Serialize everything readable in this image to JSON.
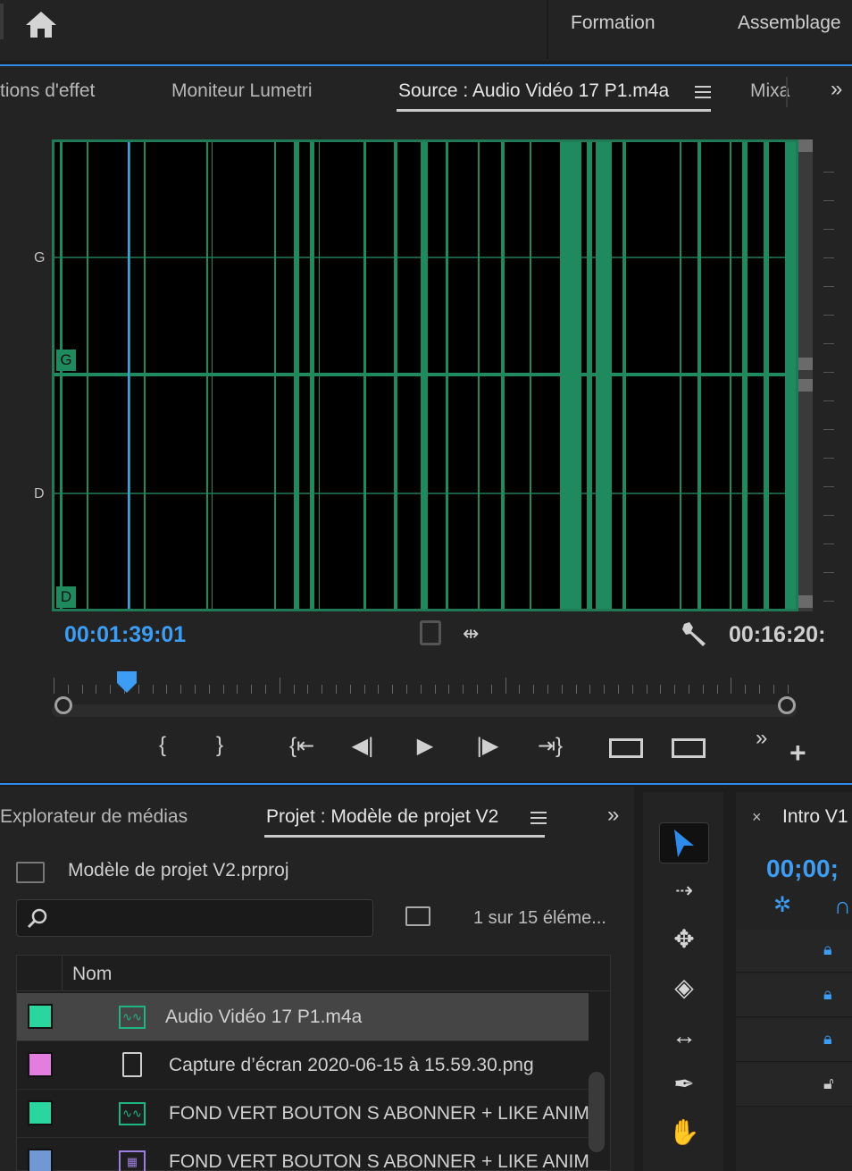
{
  "topbar": {
    "tabs": [
      "Formation",
      "Assemblage"
    ]
  },
  "source_panel": {
    "tabs": [
      {
        "label": "tions d'effet"
      },
      {
        "label": "Moniteur Lumetri"
      },
      {
        "label": "Source : Audio Vidéo 17 P1.m4a",
        "active": true
      },
      {
        "label": "Mixa"
      }
    ],
    "channels": {
      "left": "G",
      "right": "D"
    },
    "timecode_current": "00:01:39:01",
    "timecode_duration": "00:16:20:"
  },
  "transport": {
    "buttons": [
      "mark-in",
      "mark-out",
      "go-to-in",
      "step-back",
      "play",
      "step-forward",
      "go-to-out",
      "insert",
      "overwrite"
    ],
    "more": "»",
    "add": "+"
  },
  "project_panel": {
    "tabs": [
      {
        "label": "Explorateur de médias"
      },
      {
        "label": "Projet : Modèle de projet V2",
        "active": true
      }
    ],
    "project_file": "Modèle de projet V2.prproj",
    "search_placeholder": "",
    "count_text": "1 sur 15 éléme...",
    "column_header": "Nom",
    "items": [
      {
        "name": "Audio Vidéo 17 P1.m4a",
        "color": "#2bd69e",
        "icon": "audio-file-icon",
        "selected": true
      },
      {
        "name": "Capture d’écran 2020-06-15 à 15.59.30.png",
        "color": "#e37de0",
        "icon": "image-file-icon"
      },
      {
        "name": "FOND VERT BOUTON S ABONNER + LIKE ANIMA",
        "color": "#2bd69e",
        "icon": "audio-file-icon"
      },
      {
        "name": "FOND VERT BOUTON S ABONNER + LIKE ANIMA",
        "color": "#6f98d4",
        "icon": "video-file-icon"
      }
    ]
  },
  "tools_panel": {
    "tools": [
      "selection-tool",
      "track-select-tool",
      "ripple-edit-tool",
      "razor-tool",
      "slip-tool",
      "pen-tool",
      "hand-tool"
    ]
  },
  "timeline_panel": {
    "title": "Intro V1",
    "timecode": "00;00;"
  },
  "colors": {
    "accent": "#2d8ceb",
    "timecode": "#3d9df5",
    "waveform": "#1f8a5e"
  }
}
